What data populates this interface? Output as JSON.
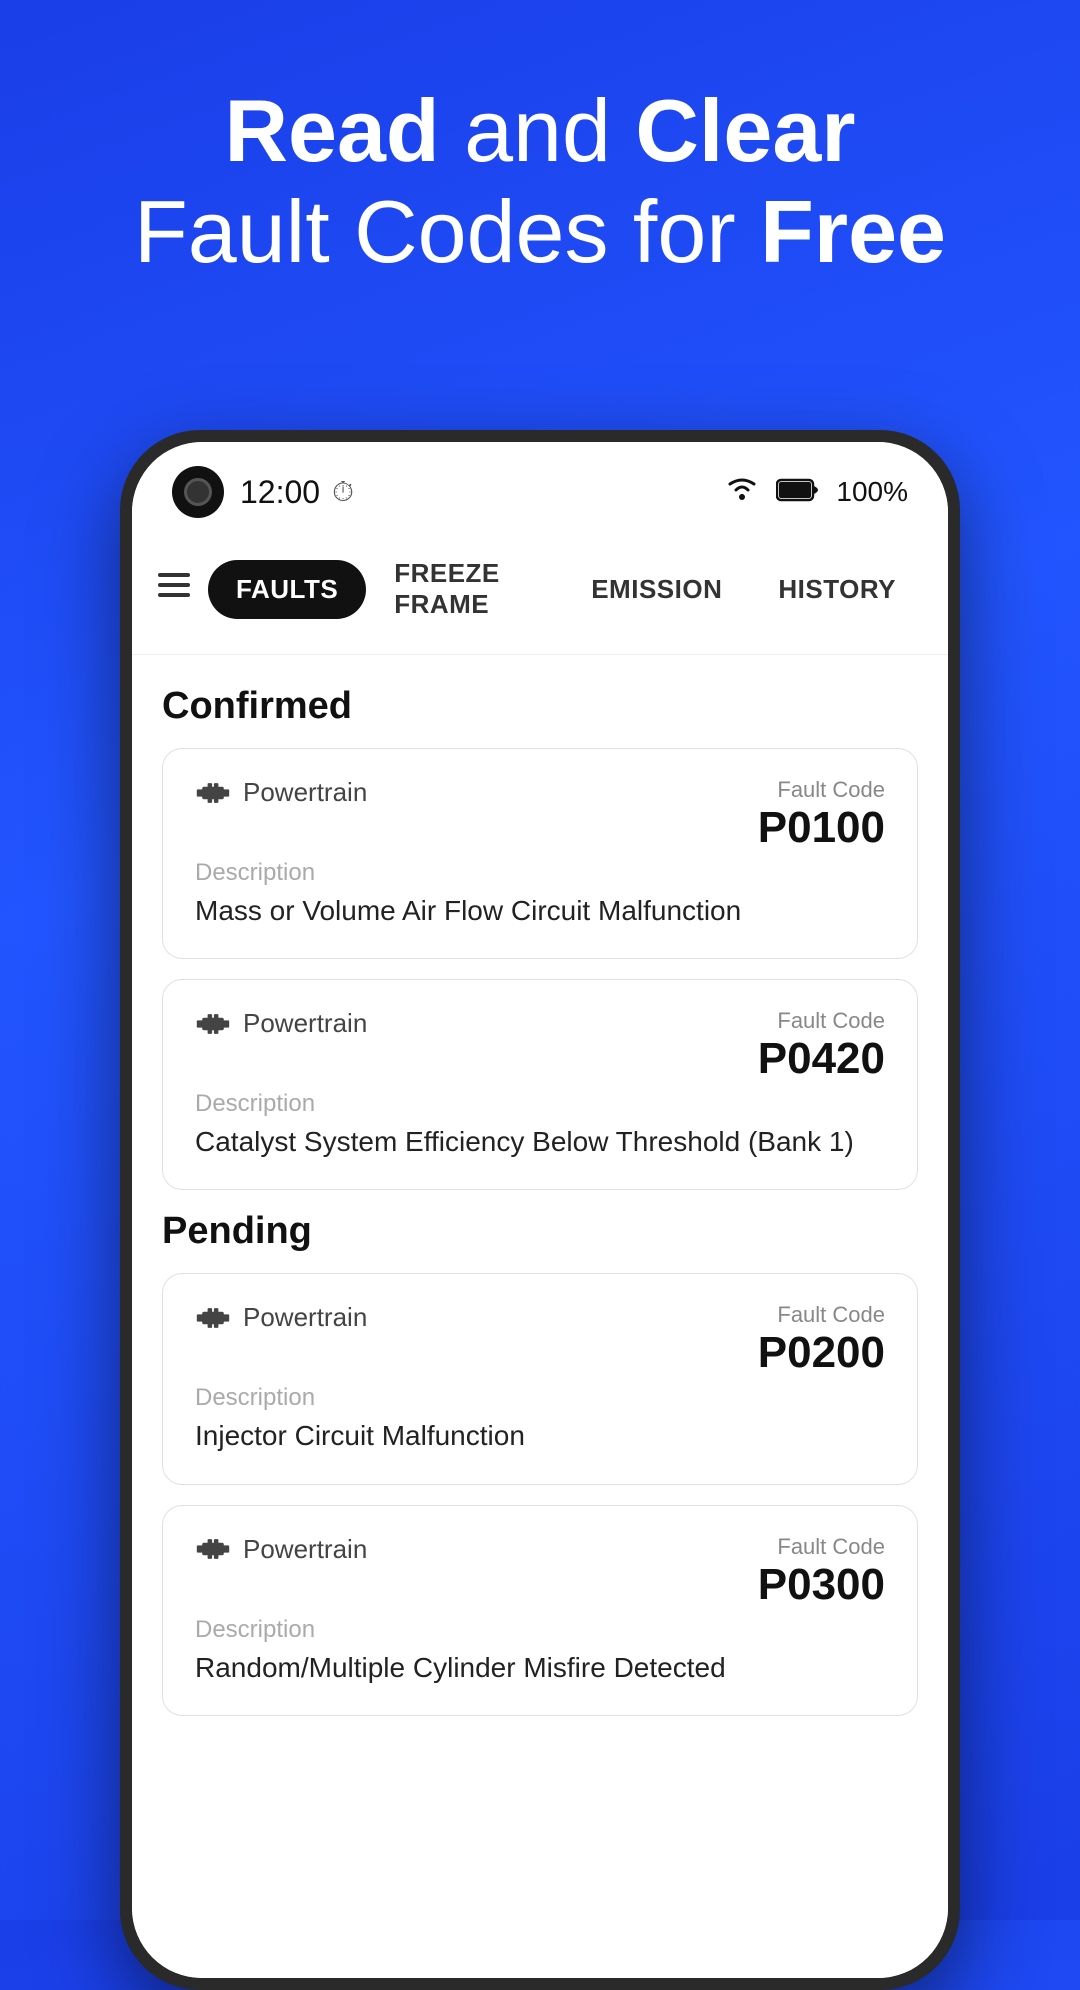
{
  "hero": {
    "line1_normal": "and",
    "line1_bold1": "Read",
    "line1_bold2": "Clear",
    "line2_normal": "Fault Codes for",
    "line2_bold": "Free"
  },
  "status_bar": {
    "time": "12:00",
    "battery": "100%"
  },
  "tabs": [
    {
      "id": "faults",
      "label": "Faults",
      "active": true
    },
    {
      "id": "freeze-frame",
      "label": "Freeze Frame",
      "active": false
    },
    {
      "id": "emission",
      "label": "Emission",
      "active": false
    },
    {
      "id": "history",
      "label": "History",
      "active": false
    }
  ],
  "sections": [
    {
      "title": "Confirmed",
      "cards": [
        {
          "system": "Powertrain",
          "fault_code_label": "Fault Code",
          "fault_code": "P0100",
          "description_label": "Description",
          "description": "Mass or Volume Air Flow Circuit Malfunction"
        },
        {
          "system": "Powertrain",
          "fault_code_label": "Fault Code",
          "fault_code": "P0420",
          "description_label": "Description",
          "description": "Catalyst System Efficiency Below Threshold (Bank 1)"
        }
      ]
    },
    {
      "title": "Pending",
      "cards": [
        {
          "system": "Powertrain",
          "fault_code_label": "Fault Code",
          "fault_code": "P0200",
          "description_label": "Description",
          "description": "Injector Circuit Malfunction"
        },
        {
          "system": "Powertrain",
          "fault_code_label": "Fault Code",
          "fault_code": "P0300",
          "description_label": "Description",
          "description": "Random/Multiple Cylinder Misfire Detected"
        }
      ]
    }
  ]
}
